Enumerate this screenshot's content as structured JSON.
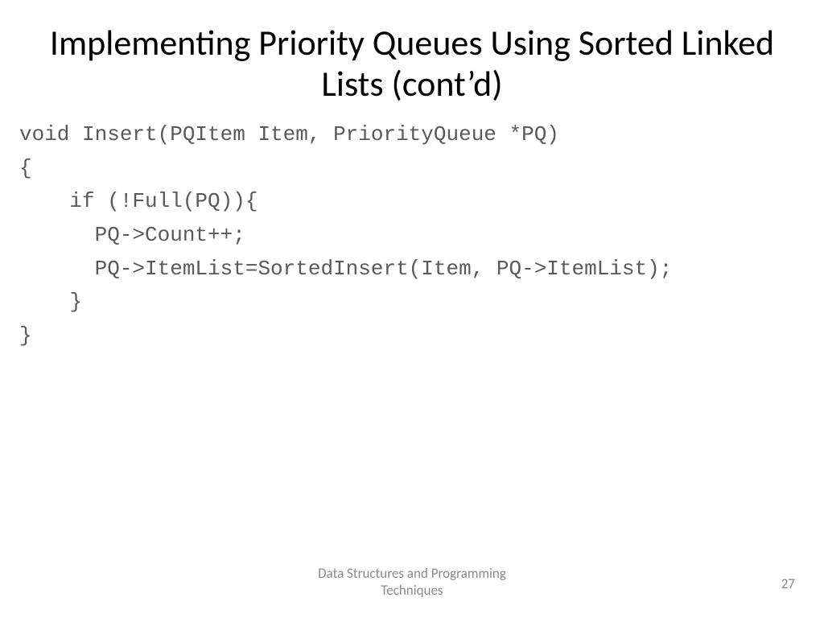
{
  "title": "Implementing Priority Queues Using Sorted Linked Lists (cont’d)",
  "code": {
    "l0": "void Insert(PQItem Item, PriorityQueue *PQ)",
    "l1": "{",
    "l2": "    if (!Full(PQ)){",
    "l3": "      PQ->Count++;",
    "l4": "      PQ->ItemList=SortedInsert(Item, PQ->ItemList);",
    "l5": "    }",
    "l6": "}"
  },
  "footer": {
    "line1": "Data Structures and Programming",
    "line2": "Techniques"
  },
  "page_number": "27"
}
